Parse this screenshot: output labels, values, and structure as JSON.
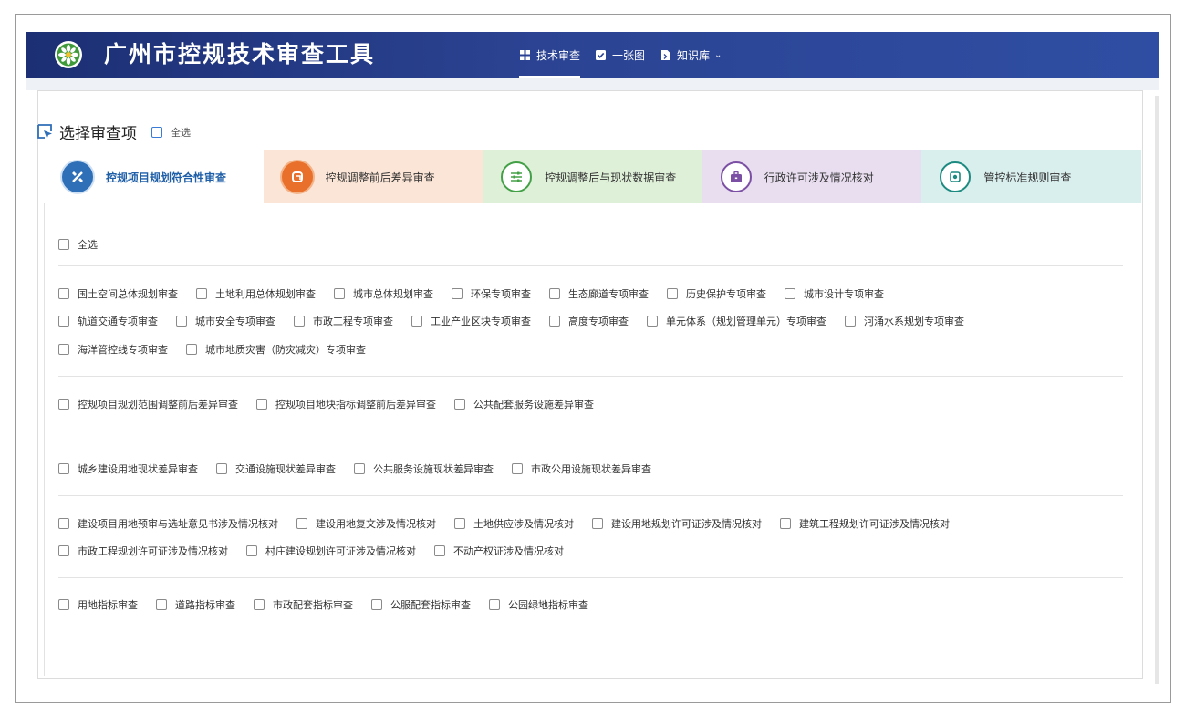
{
  "header": {
    "app_title": "广州市控规技术审查工具",
    "nav": [
      {
        "label": "技术审查",
        "icon": "grid-icon"
      },
      {
        "label": "一张图",
        "icon": "check-square-icon"
      },
      {
        "label": "知识库",
        "icon": "document-icon"
      }
    ]
  },
  "section": {
    "title": "选择审查项",
    "select_all": "全选"
  },
  "tabs": [
    {
      "label": "控规项目规划符合性审查",
      "color": "#2e6fb8",
      "bg": "#ffffff",
      "icon": "tools-icon"
    },
    {
      "label": "控规调整前后差异审查",
      "color": "#e8702a",
      "bg": "#fbe5d6",
      "icon": "compare-icon"
    },
    {
      "label": "控规调整后与现状数据审查",
      "color": "#43a047",
      "bg": "#dff0d8",
      "icon": "sliders-icon"
    },
    {
      "label": "行政许可涉及情况核对",
      "color": "#7b4fa3",
      "bg": "#e8def0",
      "icon": "briefcase-icon"
    },
    {
      "label": "管控标准规则审查",
      "color": "#1c8a80",
      "bg": "#d9efee",
      "icon": "target-icon"
    }
  ],
  "panel": {
    "select_all": "全选",
    "groups": [
      [
        [
          "国土空间总体规划审查",
          "土地利用总体规划审查",
          "城市总体规划审查",
          "环保专项审查",
          "生态廊道专项审查",
          "历史保护专项审查",
          "城市设计专项审查"
        ],
        [
          "轨道交通专项审查",
          "城市安全专项审查",
          "市政工程专项审查",
          "工业产业区块专项审查",
          "高度专项审查",
          "单元体系（规划管理单元）专项审查",
          "河涌水系规划专项审查"
        ],
        [
          "海洋管控线专项审查",
          "城市地质灾害（防灾减灾）专项审查"
        ]
      ],
      [
        [
          "控规项目规划范围调整前后差异审查",
          "控规项目地块指标调整前后差异审查",
          "公共配套服务设施差异审查"
        ]
      ],
      [
        [
          "城乡建设用地现状差异审查",
          "交通设施现状差异审查",
          "公共服务设施现状差异审查",
          "市政公用设施现状差异审查"
        ]
      ],
      [
        [
          "建设项目用地预审与选址意见书涉及情况核对",
          "建设用地复文涉及情况核对",
          "土地供应涉及情况核对",
          "建设用地规划许可证涉及情况核对",
          "建筑工程规划许可证涉及情况核对"
        ],
        [
          "市政工程规划许可证涉及情况核对",
          "村庄建设规划许可证涉及情况核对",
          "不动产权证涉及情况核对"
        ]
      ],
      [
        [
          "用地指标审查",
          "道路指标审查",
          "市政配套指标审查",
          "公服配套指标审查",
          "公园绿地指标审查"
        ]
      ]
    ]
  }
}
